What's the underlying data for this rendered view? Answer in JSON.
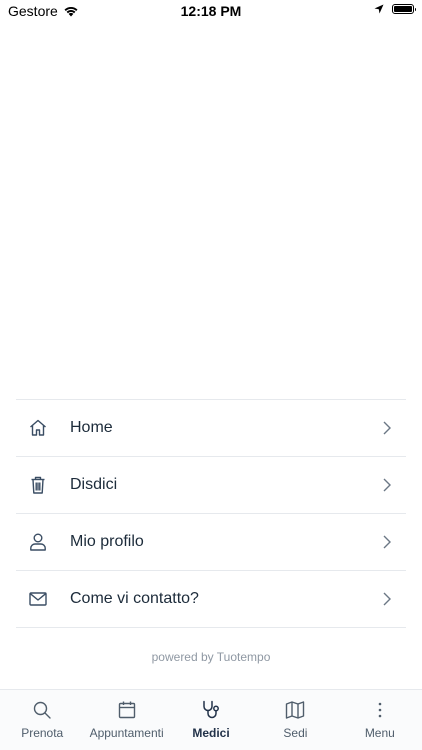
{
  "status_bar": {
    "carrier": "Gestore",
    "time": "12:18 PM"
  },
  "menu": {
    "items": [
      {
        "label": "Home",
        "icon": "home-icon"
      },
      {
        "label": "Disdici",
        "icon": "trash-icon"
      },
      {
        "label": "Mio profilo",
        "icon": "user-icon"
      },
      {
        "label": "Come vi contatto?",
        "icon": "mail-icon"
      }
    ]
  },
  "footer": {
    "powered_by": "powered by Tuotempo"
  },
  "tab_bar": {
    "active": "Medici",
    "tabs": [
      {
        "label": "Prenota",
        "icon": "search-icon"
      },
      {
        "label": "Appuntamenti",
        "icon": "calendar-icon"
      },
      {
        "label": "Medici",
        "icon": "stethoscope-icon"
      },
      {
        "label": "Sedi",
        "icon": "map-icon"
      },
      {
        "label": "Menu",
        "icon": "more-vertical-icon"
      }
    ]
  },
  "colors": {
    "text": "#1c2b3a",
    "icon": "#3a4d63",
    "divider": "#e6e9ed",
    "muted": "#8f98a3",
    "active_tab": "#23334a"
  }
}
